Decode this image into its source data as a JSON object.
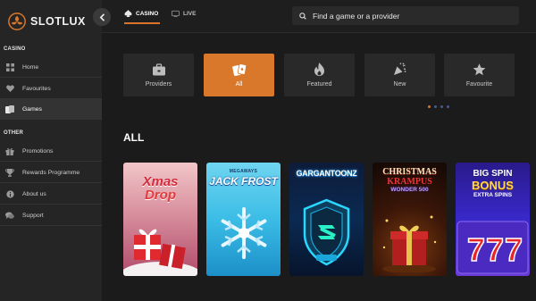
{
  "brand": {
    "name": "SLOTLUX",
    "accent": "#d9772b"
  },
  "sidebar": {
    "sections": [
      {
        "label": "CASINO"
      },
      {
        "label": "OTHER"
      }
    ],
    "casino_items": [
      {
        "label": "Home",
        "icon": "grid-icon"
      },
      {
        "label": "Favourites",
        "icon": "heart-icon"
      },
      {
        "label": "Games",
        "icon": "cards-icon",
        "active": true
      }
    ],
    "other_items": [
      {
        "label": "Promotions",
        "icon": "gift-icon"
      },
      {
        "label": "Rewards Programme",
        "icon": "trophy-icon"
      },
      {
        "label": "About us",
        "icon": "info-icon"
      },
      {
        "label": "Support",
        "icon": "chat-icon"
      }
    ]
  },
  "topbar": {
    "tabs": [
      {
        "label": "CASINO",
        "icon": "spade-icon",
        "active": true
      },
      {
        "label": "LIVE",
        "icon": "tv-icon"
      }
    ],
    "search": {
      "placeholder": "Find a game or a provider"
    }
  },
  "categories": [
    {
      "label": "Providers",
      "icon": "briefcase-icon"
    },
    {
      "label": "All",
      "icon": "cards-icon",
      "active": true
    },
    {
      "label": "Featured",
      "icon": "flame-icon"
    },
    {
      "label": "New",
      "icon": "party-icon"
    },
    {
      "label": "Favourite",
      "icon": "star-icon"
    }
  ],
  "carousel": {
    "pages": 4,
    "active_page": 1
  },
  "section_title": "ALL",
  "games": [
    {
      "title_line1": "Xmas",
      "title_line2": "Drop"
    },
    {
      "title_line1": "MEGAWAYS",
      "title_line2": "JACK FROST"
    },
    {
      "title_line1": "GARGANTOONZ",
      "title_line2": ""
    },
    {
      "title_line1": "CHRISTMAS",
      "title_line2": "KRAMPUS",
      "title_line3": "WONDER 500"
    },
    {
      "title_line1": "BIG SPIN",
      "title_line2": "BONUS",
      "title_line3": "EXTRA SPINS"
    }
  ]
}
